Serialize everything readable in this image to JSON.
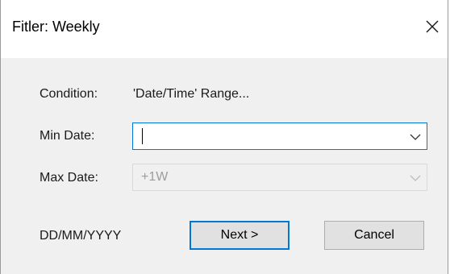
{
  "window": {
    "title": "Fitler: Weekly"
  },
  "form": {
    "condition_label": "Condition:",
    "condition_value": "'Date/Time' Range...",
    "min_date_label": "Min Date:",
    "min_date_value": "",
    "max_date_label": "Max Date:",
    "max_date_value": "+1W",
    "format_hint": "DD/MM/YYYY"
  },
  "buttons": {
    "next_label": "Next >",
    "cancel_label": "Cancel"
  },
  "icons": {
    "close": "close-icon",
    "dropdown": "chevron-down-icon"
  },
  "colors": {
    "accent": "#0078d7",
    "dialog_bg": "#f0f0f0",
    "titlebar_bg": "#ffffff",
    "disabled_text": "#9d9d9d"
  }
}
